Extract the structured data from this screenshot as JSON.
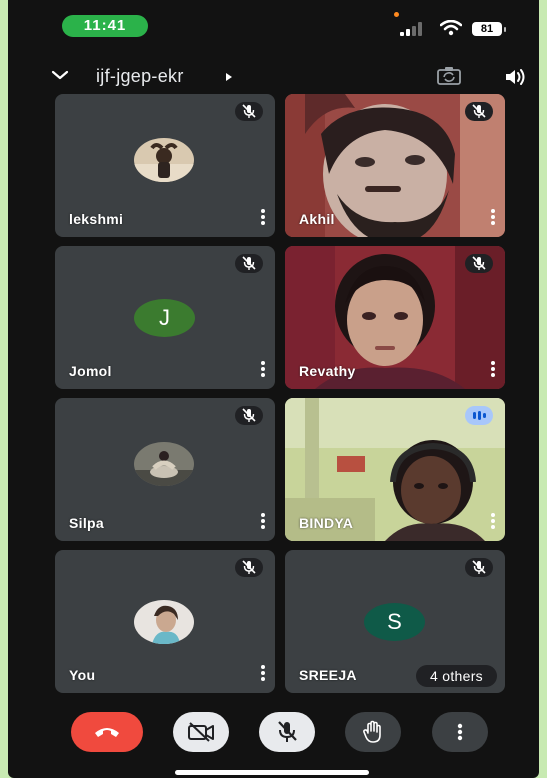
{
  "status": {
    "time": "11:41",
    "battery": "81"
  },
  "meeting": {
    "code": "ijf-jgep-ekr"
  },
  "tiles": [
    {
      "name": "lekshmi",
      "kind": "avatar",
      "muted": true
    },
    {
      "name": "Akhil",
      "kind": "video",
      "muted": true
    },
    {
      "name": "Jomol",
      "kind": "letter",
      "letter": "J",
      "color": "#3b7b2f",
      "muted": true
    },
    {
      "name": "Revathy",
      "kind": "video",
      "muted": true
    },
    {
      "name": "Silpa",
      "kind": "avatar",
      "muted": true
    },
    {
      "name": "BINDYA",
      "kind": "video",
      "speaking": true
    },
    {
      "name": "You",
      "kind": "avatar",
      "muted": true
    },
    {
      "name": "SREEJA",
      "kind": "letter",
      "letter": "S",
      "color": "#0f5a48",
      "muted": true,
      "others": "4 others"
    }
  ],
  "controls": {
    "end_call": {
      "icon": "end-call-icon",
      "color": "#f04a3e"
    },
    "camera": {
      "icon": "camera-off-icon"
    },
    "mic": {
      "icon": "mic-off-icon"
    },
    "raise_hand": {
      "icon": "hand-icon"
    },
    "more": {
      "icon": "more-vert-icon"
    }
  }
}
